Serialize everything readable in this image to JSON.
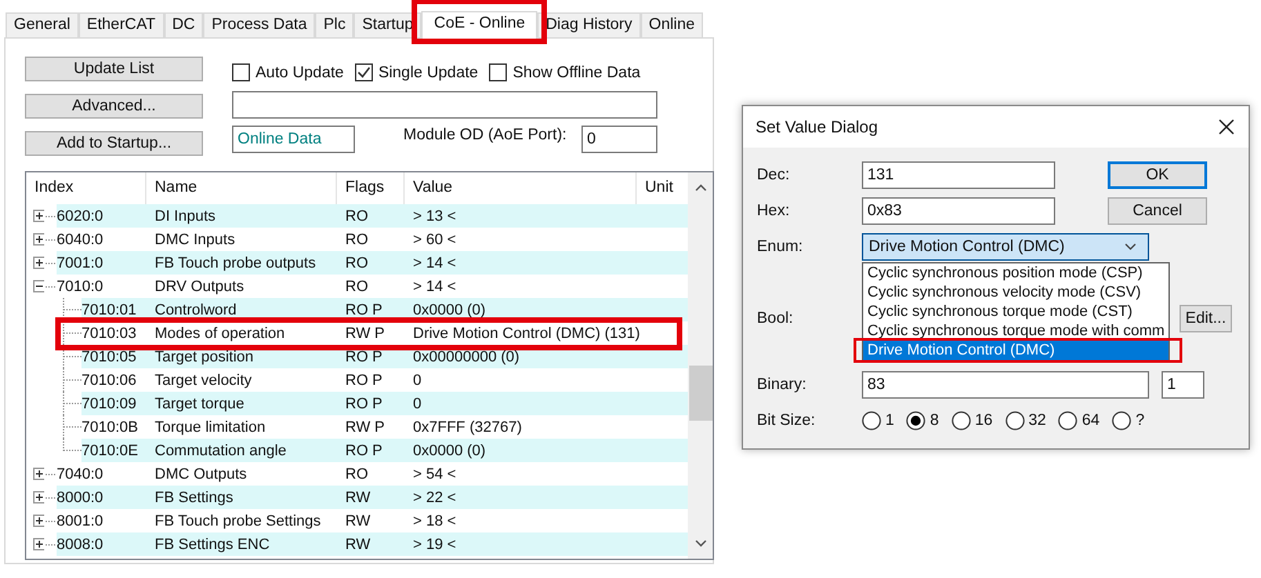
{
  "tabs": [
    {
      "label": "General",
      "selected": false,
      "highlighted": false
    },
    {
      "label": "EtherCAT",
      "selected": false,
      "highlighted": false
    },
    {
      "label": "DC",
      "selected": false,
      "highlighted": false
    },
    {
      "label": "Process Data",
      "selected": false,
      "highlighted": false
    },
    {
      "label": "Plc",
      "selected": false,
      "highlighted": false
    },
    {
      "label": "Startup",
      "selected": false,
      "highlighted": false
    },
    {
      "label": "CoE - Online",
      "selected": true,
      "highlighted": true
    },
    {
      "label": "Diag History",
      "selected": false,
      "highlighted": false
    },
    {
      "label": "Online",
      "selected": false,
      "highlighted": false
    }
  ],
  "buttons": [
    "Update List",
    "Advanced...",
    "Add to Startup..."
  ],
  "options": [
    {
      "label": "Auto Update",
      "checked": false
    },
    {
      "label": "Single Update",
      "checked": true
    },
    {
      "label": "Show Offline Data",
      "checked": false
    }
  ],
  "source_field": {
    "value": "Online Data"
  },
  "module_od": {
    "label": "Module OD (AoE Port):",
    "value": "0"
  },
  "table": {
    "columns": [
      "Index",
      "Name",
      "Flags",
      "Value",
      "Unit"
    ],
    "rows": [
      {
        "index": "6020:0",
        "name": "DI Inputs",
        "flags": "RO",
        "value": "> 13 <",
        "expanded": false,
        "highlighted": false
      },
      {
        "index": "6040:0",
        "name": "DMC Inputs",
        "flags": "RO",
        "value": "> 60 <",
        "expanded": false,
        "highlighted": false
      },
      {
        "index": "7001:0",
        "name": "FB Touch probe  outputs",
        "flags": "RO",
        "value": "> 14 <",
        "expanded": false,
        "highlighted": false
      },
      {
        "index": "7010:0",
        "name": "DRV Outputs",
        "flags": "RO",
        "value": "> 14 <",
        "expanded": true,
        "highlighted": false,
        "children": [
          {
            "index": "7010:01",
            "name": "Controlword",
            "flags": "RO P",
            "value": "0x0000 (0)",
            "highlighted": false
          },
          {
            "index": "7010:03",
            "name": "Modes of operation",
            "flags": "RW P",
            "value": "Drive Motion Control (DMC) (131)",
            "highlighted": true
          },
          {
            "index": "7010:05",
            "name": "Target position",
            "flags": "RO P",
            "value": "0x00000000 (0)",
            "highlighted": false
          },
          {
            "index": "7010:06",
            "name": "Target velocity",
            "flags": "RO P",
            "value": "0",
            "highlighted": false
          },
          {
            "index": "7010:09",
            "name": "Target torque",
            "flags": "RO P",
            "value": "0",
            "highlighted": false
          },
          {
            "index": "7010:0B",
            "name": "Torque limitation",
            "flags": "RW P",
            "value": "0x7FFF (32767)",
            "highlighted": false
          },
          {
            "index": "7010:0E",
            "name": "Commutation angle",
            "flags": "RO P",
            "value": "0x0000 (0)",
            "highlighted": false
          }
        ]
      },
      {
        "index": "7040:0",
        "name": "DMC Outputs",
        "flags": "RO",
        "value": "> 54 <",
        "expanded": false,
        "highlighted": false
      },
      {
        "index": "8000:0",
        "name": "FB Settings",
        "flags": "RW",
        "value": "> 22 <",
        "expanded": false,
        "highlighted": false
      },
      {
        "index": "8001:0",
        "name": "FB Touch probe Settings",
        "flags": "RW",
        "value": "> 18 <",
        "expanded": false,
        "highlighted": false
      },
      {
        "index": "8008:0",
        "name": "FB Settings ENC",
        "flags": "RW",
        "value": "> 19 <",
        "expanded": false,
        "highlighted": false
      }
    ]
  },
  "dialog": {
    "title": "Set Value Dialog",
    "fields": [
      {
        "label": "Dec:",
        "value": "131"
      },
      {
        "label": "Hex:",
        "value": "0x83"
      }
    ],
    "buttons": [
      {
        "label": "OK",
        "focused": true
      },
      {
        "label": "Cancel",
        "focused": false
      }
    ],
    "enum": {
      "label": "Enum:",
      "value": "Drive Motion Control (DMC)",
      "expanded": true,
      "highlighted": true,
      "options": [
        {
          "label": "Cyclic synchronous position mode (CSP)",
          "selected": false
        },
        {
          "label": "Cyclic synchronous velocity mode (CSV)",
          "selected": false
        },
        {
          "label": "Cyclic synchronous torque mode (CST)",
          "selected": false
        },
        {
          "label": "Cyclic synchronous torque mode with comm",
          "selected": false
        },
        {
          "label": "Drive Motion Control (DMC)",
          "selected": true
        }
      ]
    },
    "bool": {
      "label": "Bool:",
      "button": "Edit..."
    },
    "binary": {
      "label": "Binary:",
      "value": "83",
      "size": "1"
    },
    "bit_size": {
      "label": "Bit Size:",
      "options": [
        {
          "label": "1",
          "selected": false
        },
        {
          "label": "8",
          "selected": true
        },
        {
          "label": "16",
          "selected": false
        },
        {
          "label": "32",
          "selected": false
        },
        {
          "label": "64",
          "selected": false
        },
        {
          "label": "?",
          "selected": false
        }
      ]
    }
  }
}
